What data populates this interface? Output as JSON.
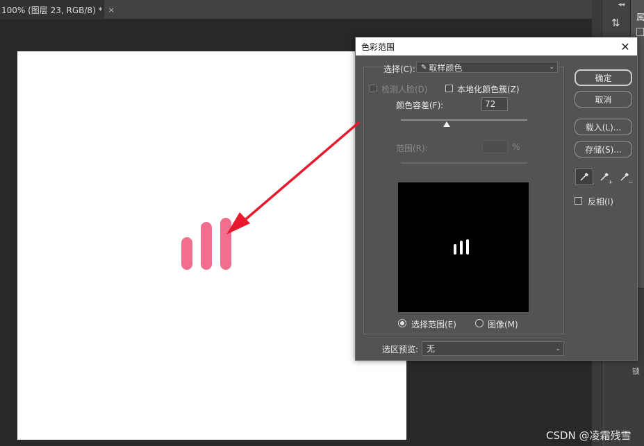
{
  "document": {
    "tab_title": "100% (图层 23, RGB/8) *",
    "tab_close": "×"
  },
  "dock": {
    "collapse_glyph": "◂◂",
    "panel_char": "属",
    "lock_label": "锁"
  },
  "dialog": {
    "title": "色彩范围",
    "close_glyph": "✕",
    "select_label": "选择(C):",
    "select_value": "取样颜色",
    "detect_faces_label": "检测人脸(D)",
    "localized_clusters_label": "本地化颜色簇(Z)",
    "fuzziness_label": "颜色容差(F):",
    "fuzziness_value": "72",
    "fuzziness_fraction": 0.36,
    "range_label": "范围(R):",
    "range_value": "",
    "range_unit": "%",
    "radio_selection_label": "选择范围(E)",
    "radio_image_label": "图像(M)",
    "selected_view": "selection",
    "selection_preview_label": "选区预览:",
    "selection_preview_value": "无",
    "buttons": {
      "ok": "确定",
      "cancel": "取消",
      "load": "载入(L)...",
      "save": "存储(S)..."
    },
    "invert_label": "反相(I)",
    "eyedroppers": {
      "add_sign": "+",
      "subtract_sign": "−"
    }
  },
  "watermark": "CSDN @凌霜残雪",
  "colors": {
    "accent_bar": "#f06e8e",
    "arrow": "#e8192c"
  }
}
